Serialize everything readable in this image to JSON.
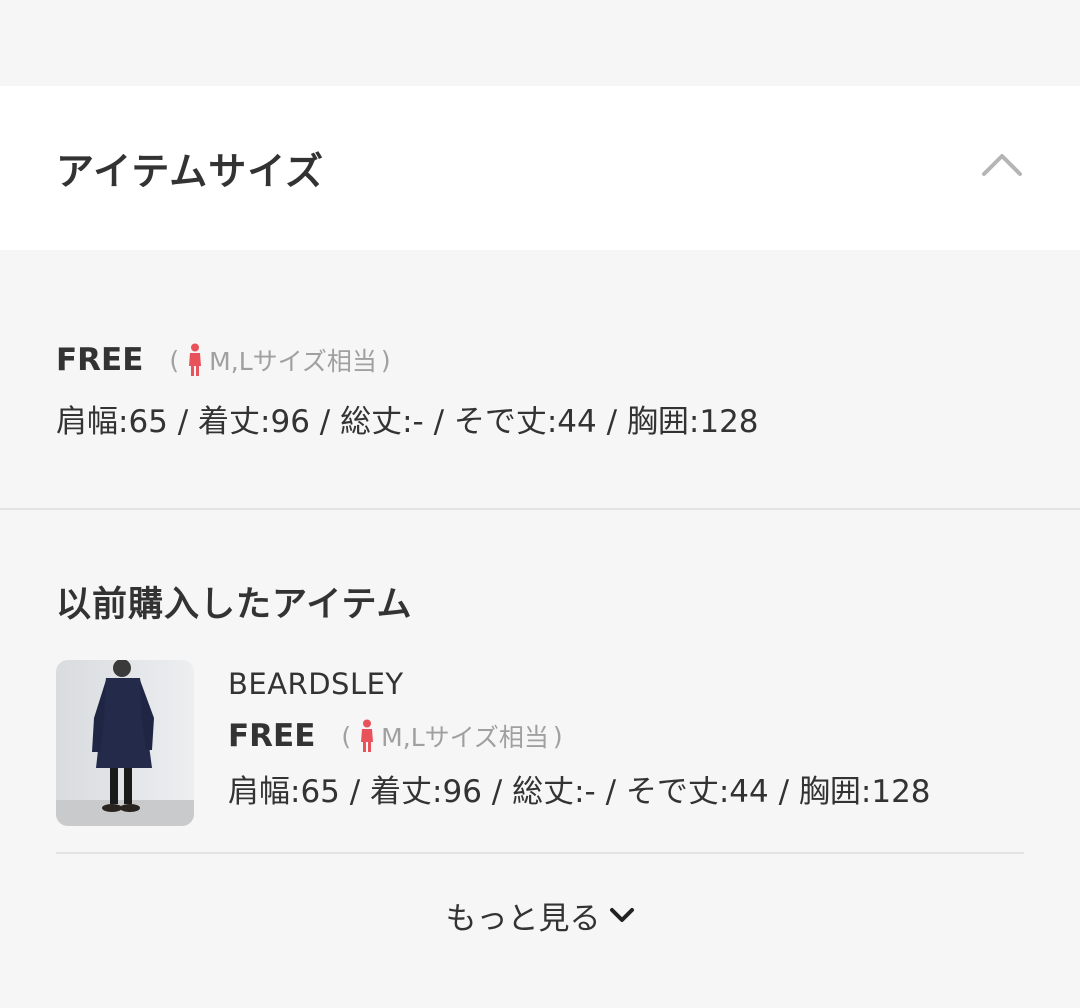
{
  "header": {
    "title": "アイテムサイズ",
    "collapse_icon": "chevron-up-icon"
  },
  "size": {
    "name": "FREE",
    "paren_open": "(",
    "equiv": "M,Lサイズ相当",
    "paren_close": ")",
    "person_icon": "woman-figure-icon",
    "person_color": "#e8525a",
    "measurements": "肩幅:65 / 着丈:96 / 総丈:- / そで丈:44 / 胸囲:128"
  },
  "previous": {
    "title": "以前購入したアイテム",
    "items": [
      {
        "brand": "BEARDSLEY",
        "size_name": "FREE",
        "paren_open": "(",
        "equiv": "M,Lサイズ相当",
        "paren_close": ")",
        "measurements": "肩幅:65 / 着丈:96 / 総丈:- / そで丈:44 / 胸囲:128"
      }
    ],
    "more_label": "もっと見る",
    "more_icon": "chevron-down-icon"
  }
}
